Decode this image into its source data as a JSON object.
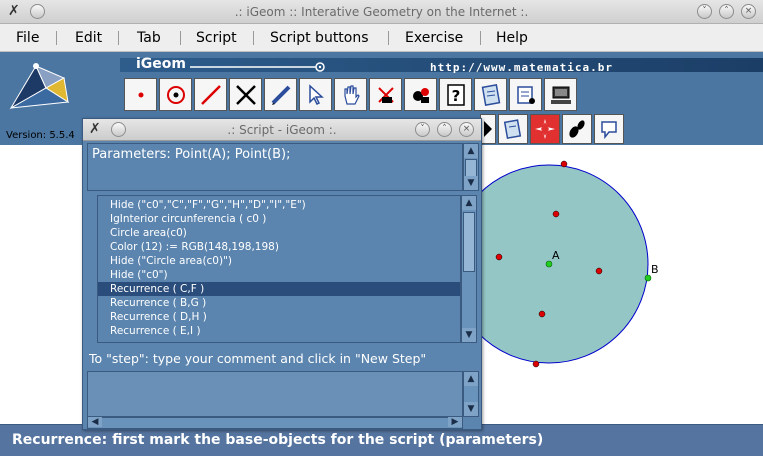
{
  "window": {
    "title": ".: iGeom :: Interative Geometry on the Internet :."
  },
  "menu": [
    "File",
    "Edit",
    "Tab",
    "Script",
    "Script buttons",
    "Exercise",
    "Help"
  ],
  "header": {
    "app_name": "iGeom",
    "url": "http://www.matematica.br",
    "version": "Version: 5.5.4"
  },
  "toolbar": {
    "row1_icons": [
      "point-tool-icon",
      "circle-point-icon",
      "segment-line-icon",
      "intersection-icon",
      "pencil-icon",
      "cursor-arrow-icon",
      "hand-move-icon",
      "delete-tool-icon",
      "paint-tool-icon",
      "help-icon",
      "script-icon",
      "script-run-icon",
      "computer-icon"
    ],
    "row2_icons": [
      "dark-tool-icon",
      "script-scroll-icon",
      "red-star-icon",
      "footprint-icon",
      "comment-icon"
    ]
  },
  "script_dialog": {
    "title": ".: Script - iGeom :.",
    "parameters": "Parameters: Point(A); Point(B);",
    "lines": [
      "Hide (\"c0\",\"C\",\"F\",\"G\",\"H\",\"D\",\"I\",\"E\")",
      "IgInterior circunferencia ( c0 )",
      "Circle area(c0)",
      "Color (12) := RGB(148,198,198)",
      "Hide (\"Circle area(c0)\")",
      "Hide (\"c0\")",
      "Recurrence ( C,F )",
      "Recurrence ( B,G )",
      "Recurrence ( D,H )",
      "Recurrence ( E,I )"
    ],
    "selected_index": 6,
    "instruction": "To \"step\": type your comment and click in \"New Step\"",
    "comment_value": ""
  },
  "canvas": {
    "circle_fill": "#94c6c6",
    "circle_stroke": "#0000cc",
    "point_labels": [
      "A",
      "B"
    ]
  },
  "status": {
    "text": "Recurrence: first mark the base-objects for the script (parameters)"
  },
  "colors": {
    "panel_blue": "#4b76a1",
    "dialog_blue": "#5b85af",
    "selected_row": "#2b4d7c",
    "status_bar": "#5575a0"
  }
}
